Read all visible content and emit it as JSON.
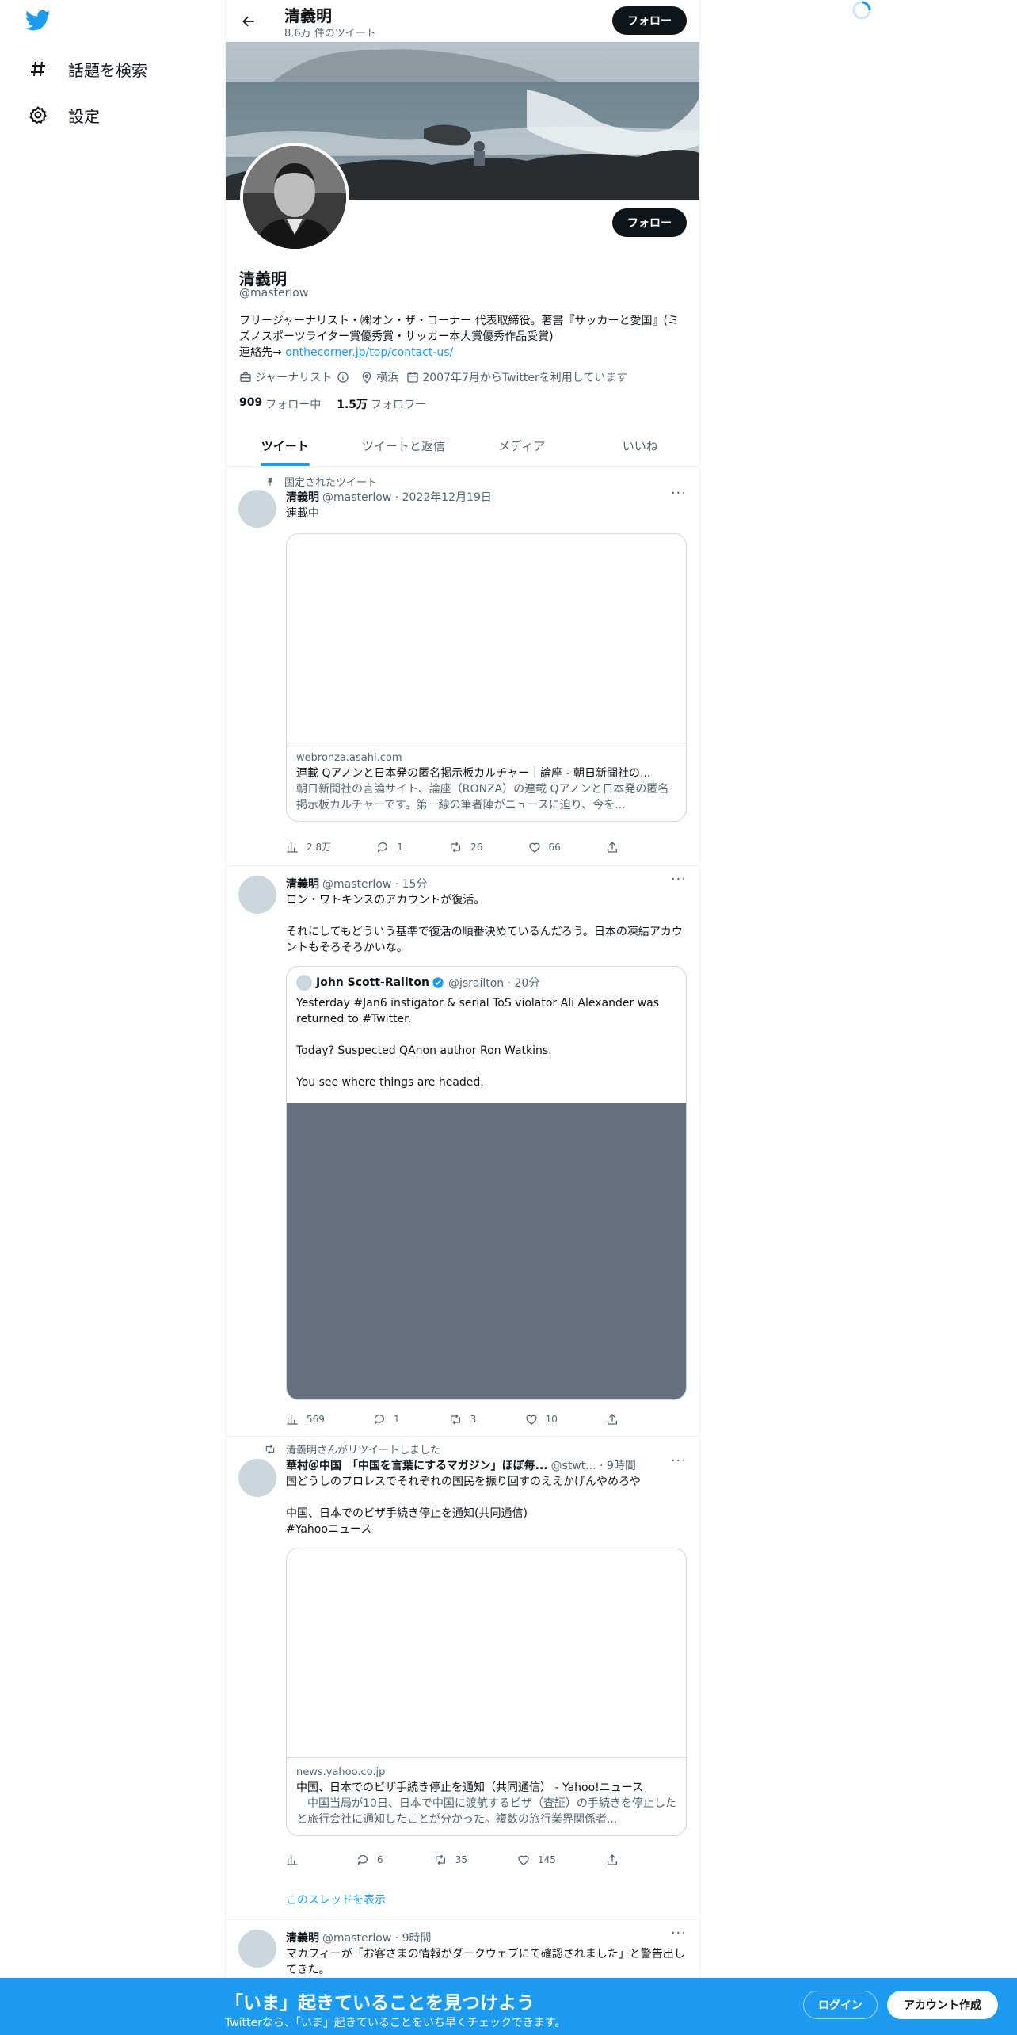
{
  "nav": {
    "explore_label": "話題を検索",
    "settings_label": "設定"
  },
  "header": {
    "name": "清義明",
    "tweet_count": "8.6万 件のツイート",
    "follow_label": "フォロー"
  },
  "profile": {
    "follow_label": "フォロー",
    "name": "清義明",
    "handle": "@masterlow",
    "bio": "フリージャーナリスト・㈱オン・ザ・コーナー 代表取締役。著書『サッカーと愛国』(ミズノスポーツライター賞優秀賞・サッカー本大賞優秀作品受賞)",
    "contact_prefix": "連絡先→ ",
    "contact_link": "onthecorner.jp/top/contact-us/",
    "profession": "ジャーナリスト",
    "location": "横浜",
    "joined": "2007年7月からTwitterを利用しています",
    "following_count": "909",
    "following_label": "フォロー中",
    "followers_count": "1.5万",
    "followers_label": "フォロワー"
  },
  "tabs": [
    "ツイート",
    "ツイートと返信",
    "メディア",
    "いいね"
  ],
  "tweets": [
    {
      "social": "固定されたツイート",
      "name": "清義明",
      "meta": "@masterlow · 2022年12月19日",
      "text": "連載中",
      "card": {
        "domain": "webronza.asahi.com",
        "title": "連載 Qアノンと日本発の匿名掲示板カルチャー｜論座 - 朝日新聞社の...",
        "desc": "朝日新聞社の言論サイト、論座（RONZA）の連載 Qアノンと日本発の匿名掲示板カルチャーです。第一線の筆者陣がニュースに迫り、今を..."
      },
      "actions": {
        "views": "2.8万",
        "replies": "1",
        "retweets": "26",
        "likes": "66"
      }
    },
    {
      "name": "清義明",
      "meta": "@masterlow · 15分",
      "text": "ロン・ワトキンスのアカウントが復活。\n\nそれにしてもどういう基準で復活の順番決めているんだろう。日本の凍結アカウントもそろそろかいな。",
      "quote": {
        "name": "John Scott-Railton",
        "meta": "@jsrailton · 20分",
        "text": "Yesterday #Jan6 instigator & serial ToS violator Ali Alexander was returned to #Twitter.\n\nToday? Suspected QAnon author Ron Watkins.\n\nYou see where things are headed."
      },
      "actions": {
        "views": "569",
        "replies": "1",
        "retweets": "3",
        "likes": "10"
      }
    },
    {
      "social": "清義明さんがリツイートしました",
      "name": "華村＠中国　「中国を言葉にするマガジン」ほぼ毎...",
      "meta": "@stwt... · 9時間",
      "text": "国どうしのプロレスでそれぞれの国民を振り回すのええかげんやめろや\n\n中国、日本でのビザ手続き停止を通知(共同通信)",
      "hashtag": "#Yahooニュース",
      "card": {
        "domain": "news.yahoo.co.jp",
        "title": "中国、日本でのビザ手続き停止を通知（共同通信） - Yahoo!ニュース",
        "desc": "　中国当局が10日、日本で中国に渡航するビザ（査証）の手続きを停止したと旅行会社に通知したことが分かった。複数の旅行業界関係者..."
      },
      "actions": {
        "views": "",
        "replies": "6",
        "retweets": "35",
        "likes": "145"
      },
      "show_thread": "このスレッドを表示"
    },
    {
      "name": "清義明",
      "meta": "@masterlow · 9時間",
      "text": "マカフィーが「お客さまの情報がダークウェブにて確認されました」と警告出してきた。"
    }
  ],
  "bottom_bar": {
    "title": "「いま」起きていることを見つけよう",
    "subtitle": "Twitterなら、「いま」起きていることをいち早くチェックできます。",
    "login_label": "ログイン",
    "signup_label": "アカウント作成"
  },
  "colors": {
    "accent": "#1d9bf0",
    "dark_button": "#0f1419",
    "secondary_text": "#536471",
    "media_placeholder": "#647080"
  },
  "icons": {
    "logo": "twitter-bird-icon",
    "explore": "hashtag-icon",
    "settings": "gear-icon",
    "back": "arrow-left-icon",
    "spinner": "loading-spinner-icon"
  }
}
